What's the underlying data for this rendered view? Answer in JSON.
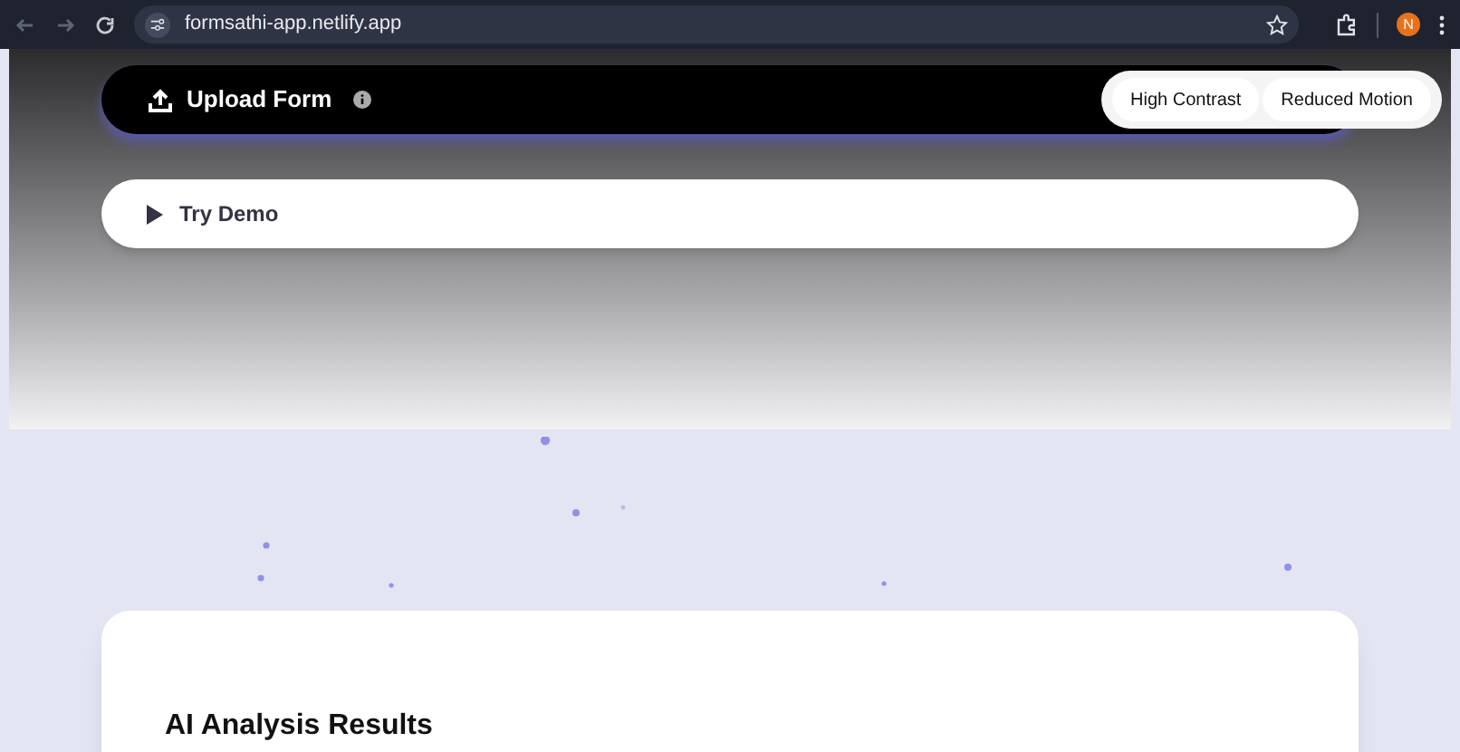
{
  "browser": {
    "url": "formsathi-app.netlify.app",
    "profile_initial": "N"
  },
  "upload": {
    "label": "Upload Form"
  },
  "toggles": [
    {
      "label": "High Contrast"
    },
    {
      "label": "Reduced Motion"
    }
  ],
  "demo": {
    "label": "Try Demo"
  },
  "results": {
    "title": "AI Analysis Results"
  }
}
